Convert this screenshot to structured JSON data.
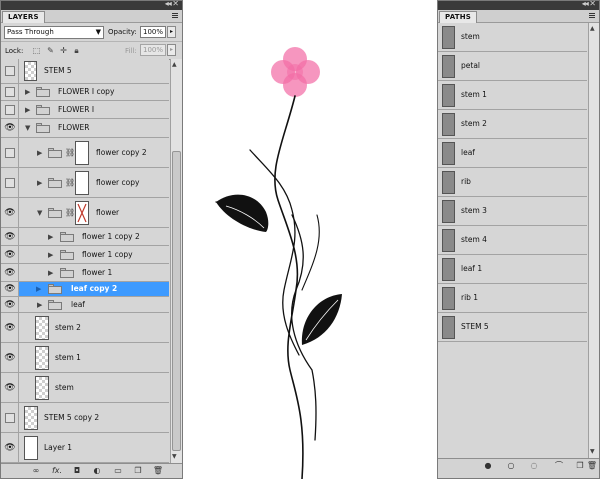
{
  "layers_panel": {
    "tab": "LAYERS",
    "blend_mode": "Pass Through",
    "opacity_label": "Opacity:",
    "opacity_value": "100%",
    "lock_label": "Lock:",
    "fill_label": "Fill:",
    "fill_value": "100%",
    "rows": [
      {
        "name": "STEM 5",
        "type": "layer",
        "visible": false,
        "selected": false
      },
      {
        "name": "FLOWER I copy",
        "type": "group",
        "visible": false,
        "selected": false
      },
      {
        "name": "FLOWER I",
        "type": "group",
        "visible": false,
        "selected": false
      },
      {
        "name": "FLOWER",
        "type": "group",
        "visible": true,
        "selected": false
      },
      {
        "name": "flower copy 2",
        "type": "group",
        "visible": false,
        "selected": false
      },
      {
        "name": "flower copy",
        "type": "group",
        "visible": false,
        "selected": false
      },
      {
        "name": "flower",
        "type": "group",
        "visible": true,
        "selected": false
      },
      {
        "name": "flower 1 copy 2",
        "type": "group",
        "visible": true,
        "selected": false
      },
      {
        "name": "flower 1 copy",
        "type": "group",
        "visible": true,
        "selected": false
      },
      {
        "name": "flower 1",
        "type": "group",
        "visible": true,
        "selected": false
      },
      {
        "name": "leaf copy 2",
        "type": "group",
        "visible": true,
        "selected": true
      },
      {
        "name": "leaf",
        "type": "group",
        "visible": true,
        "selected": false
      },
      {
        "name": "stem 2",
        "type": "layer",
        "visible": true,
        "selected": false
      },
      {
        "name": "stem 1",
        "type": "layer",
        "visible": true,
        "selected": false
      },
      {
        "name": "stem",
        "type": "layer",
        "visible": true,
        "selected": false
      },
      {
        "name": "STEM 5 copy 2",
        "type": "layer",
        "visible": false,
        "selected": false
      },
      {
        "name": "Layer 1",
        "type": "layer",
        "visible": true,
        "selected": false
      }
    ],
    "bottom_icons": [
      "link-icon",
      "fx-icon",
      "add-mask-icon",
      "adjustment-layer-icon",
      "new-group-icon",
      "new-layer-icon",
      "trash-icon"
    ]
  },
  "paths_panel": {
    "tab": "PATHS",
    "rows": [
      {
        "name": "stem"
      },
      {
        "name": "petal"
      },
      {
        "name": "stem 1"
      },
      {
        "name": "stem 2"
      },
      {
        "name": "leaf"
      },
      {
        "name": "rib"
      },
      {
        "name": "stem 3"
      },
      {
        "name": "stem 4"
      },
      {
        "name": "leaf 1"
      },
      {
        "name": "rib 1"
      },
      {
        "name": "STEM 5"
      }
    ],
    "bottom_icons": [
      "fill-path-icon",
      "stroke-path-icon",
      "load-selection-icon",
      "make-work-path-icon",
      "new-path-icon",
      "trash-icon"
    ]
  },
  "canvas": {
    "petal_color": "#f36ea6",
    "ink_color": "#111111"
  }
}
